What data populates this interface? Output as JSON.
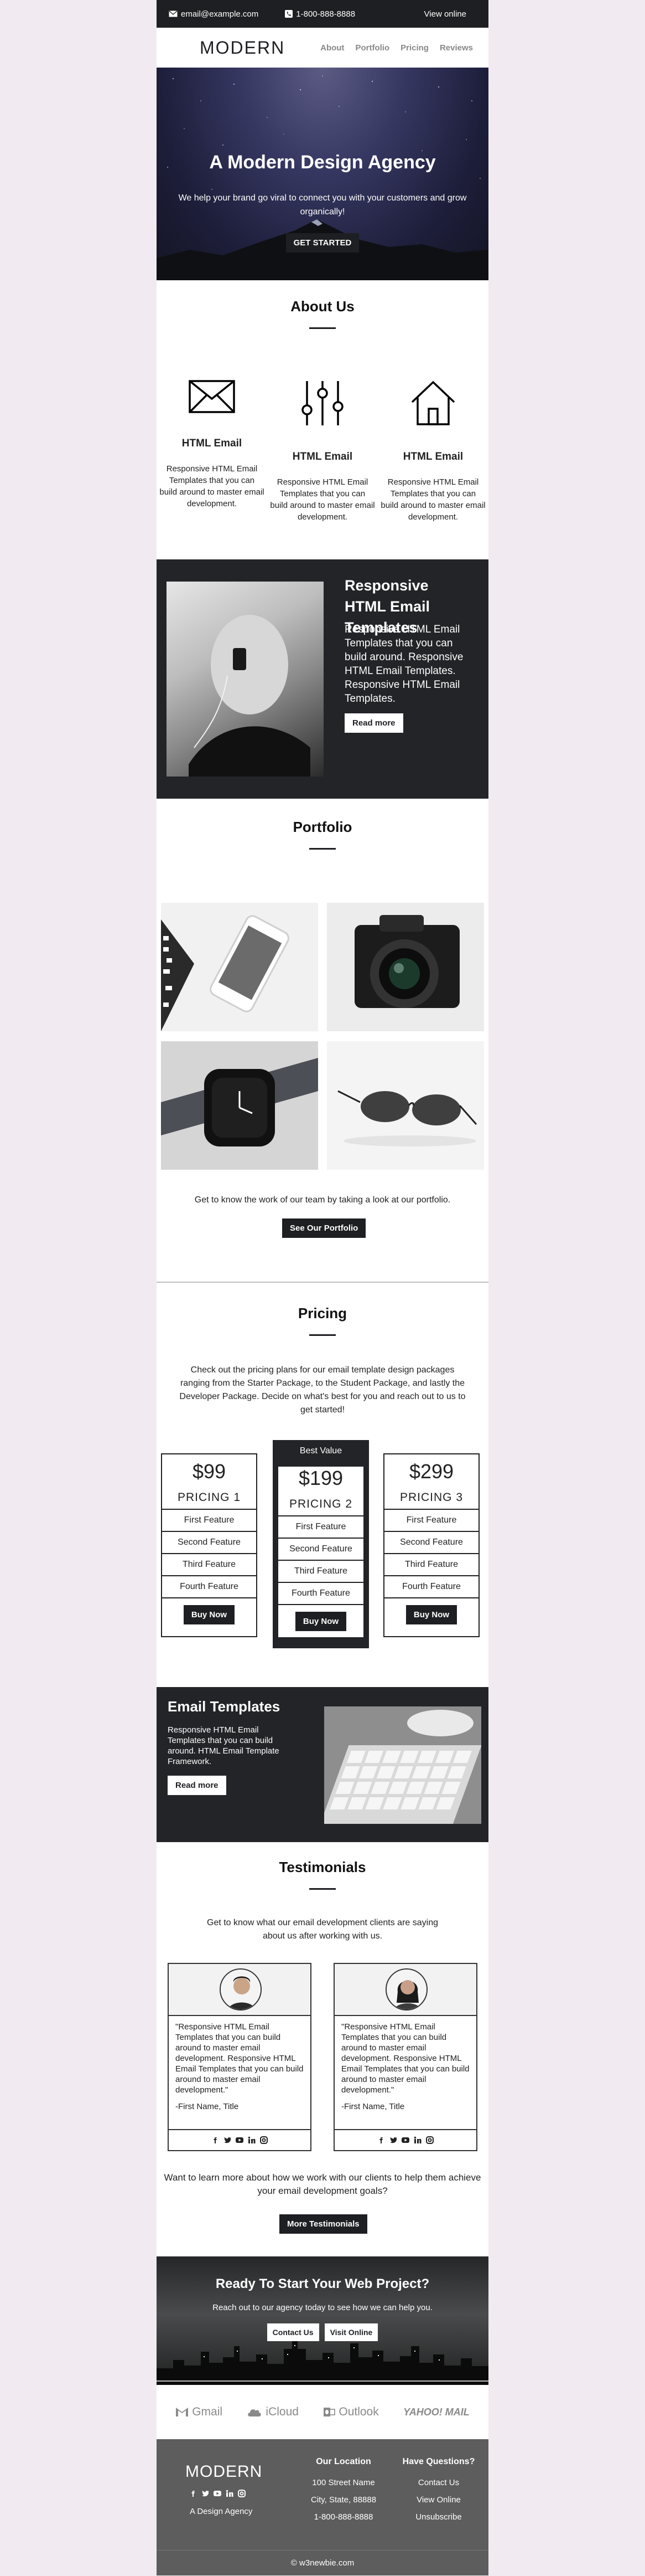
{
  "topbar": {
    "email": "email@example.com",
    "phone": "1-800-888-8888",
    "view_online": "View online"
  },
  "header": {
    "logo": "MODERN",
    "nav": [
      "About",
      "Portfolio",
      "Pricing",
      "Reviews"
    ]
  },
  "hero": {
    "title": "A Modern Design Agency",
    "text": "We help your brand go viral to connect you with your customers and grow organically!",
    "cta": "GET STARTED"
  },
  "about": {
    "title": "About Us",
    "features": [
      {
        "icon": "envelope-icon",
        "title": "HTML Email",
        "text": "Responsive HTML Email Templates that you can build around to master email development."
      },
      {
        "icon": "sliders-icon",
        "title": "HTML Email",
        "text": "Responsive HTML Email Templates that you can build around to master email development."
      },
      {
        "icon": "home-icon",
        "title": "HTML Email",
        "text": "Responsive HTML Email Templates that you can build around to master email development."
      }
    ]
  },
  "band1": {
    "title": "Responsive HTML Email Templates",
    "text": "Responsive HTML Email Templates that you can build around. Responsive HTML Email Templates. Responsive HTML Email Templates.",
    "button": "Read more"
  },
  "portfolio": {
    "title": "Portfolio",
    "caption": "Get to know the work of our team by taking a look at our portfolio.",
    "button": "See Our Portfolio"
  },
  "pricing": {
    "title": "Pricing",
    "intro": "Check out the pricing plans for our email template design packages ranging from the Starter Package, to the Student Package, and lastly the Developer Package. Decide on what's best for you and reach out to us to get started!",
    "best_value": "Best Value",
    "plans": [
      {
        "price": "$99",
        "name": "PRICING 1",
        "features": [
          "First Feature",
          "Second Feature",
          "Third Feature",
          "Fourth Feature"
        ],
        "button": "Buy Now"
      },
      {
        "price": "$199",
        "name": "PRICING 2",
        "features": [
          "First Feature",
          "Second Feature",
          "Third Feature",
          "Fourth Feature"
        ],
        "button": "Buy Now"
      },
      {
        "price": "$299",
        "name": "PRICING 3",
        "features": [
          "First Feature",
          "Second Feature",
          "Third Feature",
          "Fourth Feature"
        ],
        "button": "Buy Now"
      }
    ]
  },
  "band2": {
    "title": "Email Templates",
    "text": "Responsive HTML Email Templates that you can build around. HTML Email Template Framework.",
    "button": "Read more"
  },
  "testimonials": {
    "title": "Testimonials",
    "intro": "Get to know what our email development clients are saying about us after working with us.",
    "cards": [
      {
        "quote": "\"Responsive HTML Email Templates that you can build around to master email development. Responsive HTML Email Templates that you can build around to master email development.\"",
        "name": "-First Name, Title"
      },
      {
        "quote": "\"Responsive HTML Email Templates that you can build around to master email development. Responsive HTML Email Templates that you can build around to master email development.\"",
        "name": "-First Name, Title"
      }
    ],
    "outro": "Want to learn more about how we work with our clients to help them achieve your email development goals?",
    "button": "More Testimonials"
  },
  "cta": {
    "title": "Ready To Start Your Web Project?",
    "text": "Reach out to our agency today to see how we can help you.",
    "contact": "Contact Us",
    "visit": "Visit Online"
  },
  "brands": [
    "Gmail",
    "iCloud",
    "Outlook",
    "YAHOO! MAIL"
  ],
  "footer": {
    "logo": "MODERN",
    "tagline": "A Design Agency",
    "location_title": "Our Location",
    "address1": "100 Street Name",
    "address2": "City, State, 88888",
    "phone": "1-800-888-8888",
    "questions_title": "Have Questions?",
    "contact": "Contact Us",
    "online": "View Online",
    "unsubscribe": "Unsubscribe",
    "copyright": "© w3newbie.com"
  }
}
